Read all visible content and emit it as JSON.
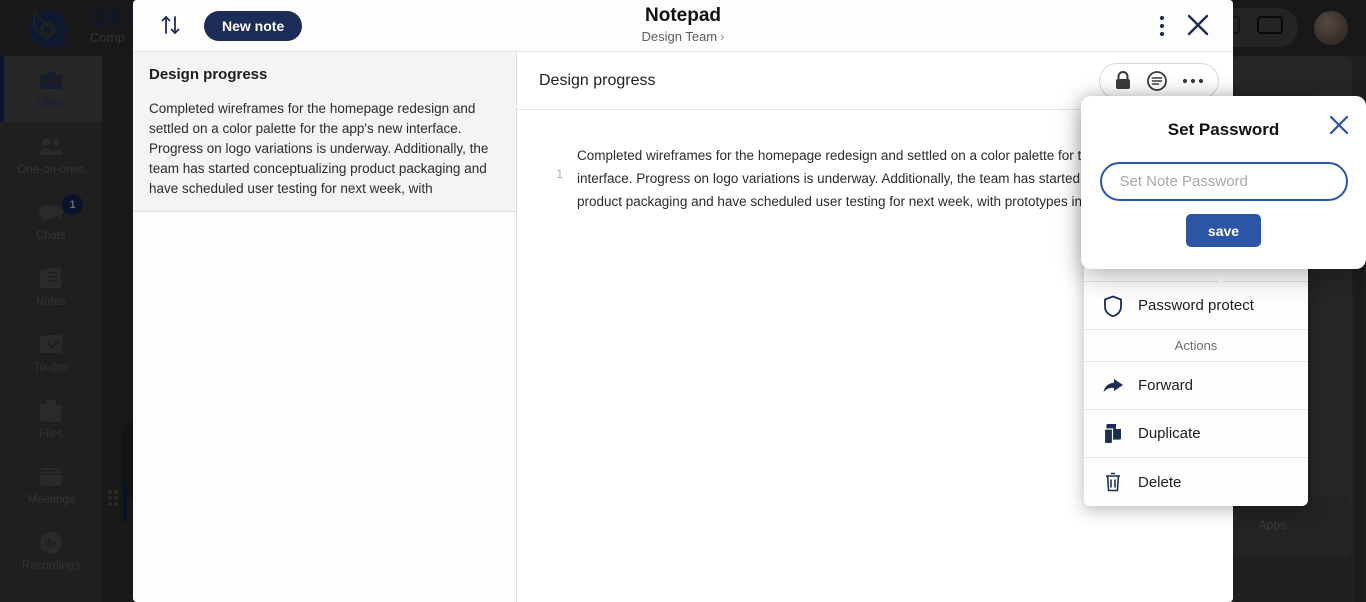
{
  "brand": {
    "logo_icon": "qik-logo-icon",
    "title": "Qik E",
    "subtitle": "Comp"
  },
  "sidebar": {
    "items": [
      {
        "label": "Office",
        "icon": "briefcase-icon",
        "active": true,
        "badge": ""
      },
      {
        "label": "One-on-ones",
        "icon": "people-icon",
        "active": false,
        "badge": ""
      },
      {
        "label": "Chats",
        "icon": "chat-bubble-icon",
        "active": false,
        "badge": "1"
      },
      {
        "label": "Notes",
        "icon": "notes-icon",
        "active": false,
        "badge": ""
      },
      {
        "label": "To-dos",
        "icon": "checkbox-icon",
        "active": false,
        "badge": ""
      },
      {
        "label": "Files",
        "icon": "files-icon",
        "active": false,
        "badge": ""
      },
      {
        "label": "Meetings",
        "icon": "meetings-icon",
        "active": false,
        "badge": ""
      },
      {
        "label": "Recordings",
        "icon": "recordings-icon",
        "active": false,
        "badge": ""
      }
    ]
  },
  "right_rail": {
    "people_icon": "people-group-icon",
    "apps_label": "Apps"
  },
  "topbar": {
    "screen_share_icon": "screen-share-icon",
    "window_icon": "window-icon",
    "avatar_icon": "user-avatar"
  },
  "notepad": {
    "sort_icon": "sort-arrows-icon",
    "new_note_label": "New note",
    "title": "Notepad",
    "breadcrumb": "Design Team",
    "breadcrumb_chevron": "›",
    "kebab_icon": "more-vertical-icon",
    "close_icon": "close-icon",
    "notes": [
      {
        "title": "Design progress",
        "preview": "Completed wireframes for the homepage redesign and settled on a color palette for the app's new interface. Progress on logo variations is underway. Additionally, the team has started conceptualizing product packaging and have scheduled user testing for next week, with"
      }
    ],
    "editor": {
      "title": "Design progress",
      "line_number": "1",
      "body": "Completed wireframes for the homepage redesign and settled on a color palette for the app's new interface. Progress on logo variations is underway. Additionally, the team has started conceptualizing product packaging and have scheduled user testing for next week, with prototypes in",
      "tools": [
        {
          "icon": "lock-icon"
        },
        {
          "icon": "comment-icon"
        },
        {
          "icon": "more-horizontal-icon"
        }
      ]
    }
  },
  "context_menu": {
    "password_protect": {
      "label": "Password protect",
      "icon": "shield-icon"
    },
    "section_label": "Actions",
    "actions": [
      {
        "label": "Forward",
        "icon": "forward-arrow-icon"
      },
      {
        "label": "Duplicate",
        "icon": "duplicate-icon"
      },
      {
        "label": "Delete",
        "icon": "trash-icon"
      }
    ]
  },
  "password_dialog": {
    "title": "Set Password",
    "close_icon": "close-icon",
    "input_value": "",
    "input_placeholder": "Set Note Password",
    "save_label": "save"
  },
  "colors": {
    "brand_navy": "#1b2c57",
    "accent_blue": "#2b55a5",
    "input_border": "#2755ab",
    "sidebar_bg": "#3a3a3a",
    "badge_bg": "#14224f"
  }
}
